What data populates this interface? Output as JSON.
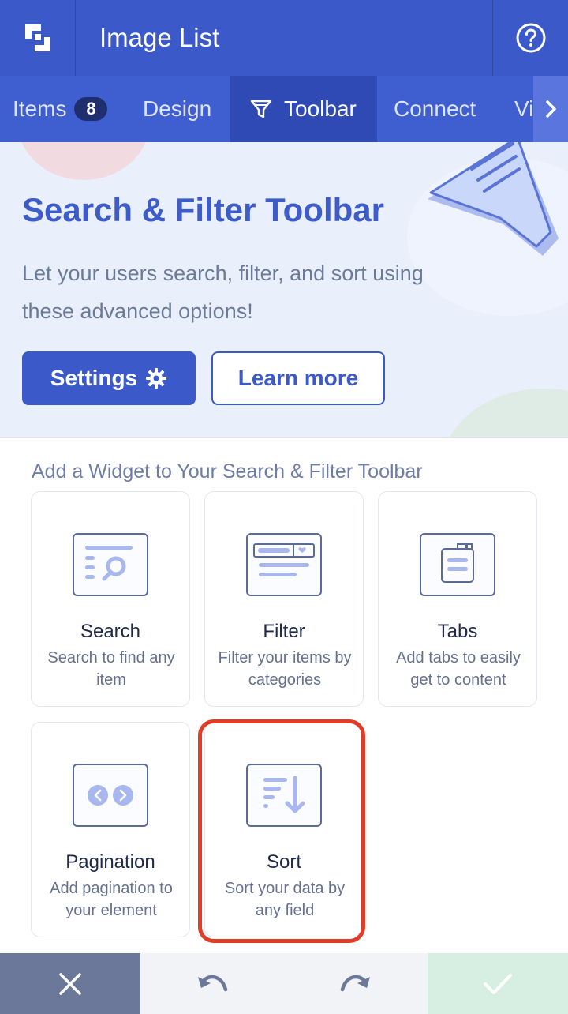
{
  "header": {
    "title": "Image List",
    "logo_icon": "app-logo-icon",
    "help_icon": "help-circle-icon"
  },
  "tabs": [
    {
      "label": "Items",
      "badge": "8"
    },
    {
      "label": "Design"
    },
    {
      "label": "Toolbar",
      "icon": "filter-icon",
      "active": true
    },
    {
      "label": "Connect"
    },
    {
      "label": "Vi"
    }
  ],
  "hero": {
    "title": "Search & Filter Toolbar",
    "description": "Let your users search, filter, and sort using these advanced options!",
    "settings_label": "Settings",
    "learn_more_label": "Learn more"
  },
  "widgets": {
    "section_title": "Add a Widget to Your Search & Filter Toolbar",
    "items": [
      {
        "title": "Search",
        "description": "Search to find any item",
        "icon": "search-widget-icon"
      },
      {
        "title": "Filter",
        "description": "Filter your items by categories",
        "icon": "filter-widget-icon"
      },
      {
        "title": "Tabs",
        "description": "Add tabs to easily get to content",
        "icon": "tabs-widget-icon"
      },
      {
        "title": "Pagination",
        "description": "Add pagination to your element",
        "icon": "pagination-widget-icon"
      },
      {
        "title": "Sort",
        "description": "Sort your data by any field",
        "icon": "sort-widget-icon",
        "highlighted": true
      }
    ]
  },
  "bottom_bar": {
    "close_icon": "close-icon",
    "undo_icon": "undo-icon",
    "redo_icon": "redo-icon",
    "confirm_icon": "check-icon"
  },
  "colors": {
    "primary": "#3b59c9",
    "header_bg": "#3b59c9",
    "tabs_bg": "#3f5fd1",
    "active_tab_bg": "#2f4ab4",
    "highlight": "#e23c27",
    "confirm_bg": "#d7efe3"
  }
}
